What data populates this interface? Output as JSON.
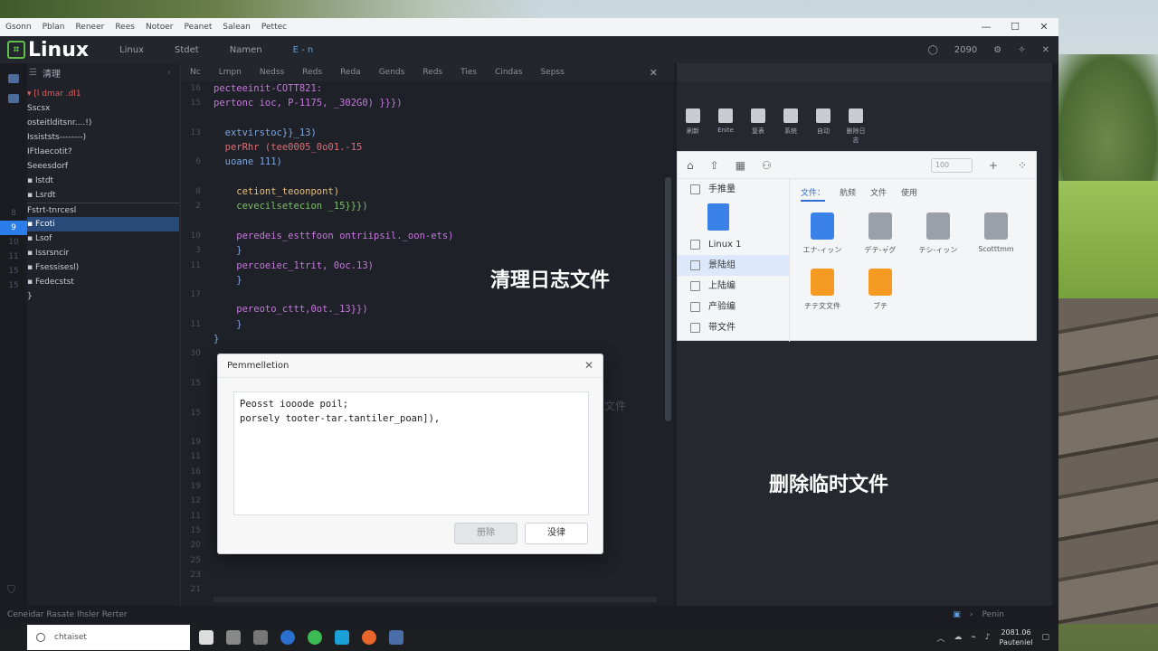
{
  "menubar": {
    "items": [
      "Gsonn",
      "Pblan",
      "Reneer",
      "Rees",
      "Notoer",
      "Peanet",
      "Salean",
      "Pettec"
    ]
  },
  "titlebar": {
    "logo": "Linux",
    "tabs": [
      "Linux",
      "Stdet",
      "Namen",
      "E - n"
    ],
    "status": "2090"
  },
  "explorer": {
    "title": "清理",
    "gutter": [
      "",
      "",
      "",
      "",
      "",
      "",
      "",
      "",
      "8",
      "9",
      "10",
      "11",
      "15",
      "15",
      "",
      "",
      "",
      "",
      "",
      "23",
      "",
      "25"
    ],
    "tree": [
      "▾ [l dmar .dl1",
      "      Sscsx",
      "      osteitlditsnr....!)",
      "      Issiststs--------)",
      "      IFtlaecotit?",
      "      Seeesdorf",
      "    ▪ Istdt",
      "    ▪ Lsrdt",
      "  Fstrt-tnrcesl",
      "    ▪ Fcoti",
      "    ▪ Lsof",
      "    ▪ Issrsncir",
      "    ▪ Fsessisesl)",
      "    ▪ Fedecstst",
      "  }"
    ]
  },
  "editor": {
    "tabs": [
      "Nc",
      "Lmpn",
      "Nedss",
      "Reds",
      "Reda",
      "Gends",
      "Reds",
      "Ties",
      "Cindas",
      "Sepss"
    ],
    "line_numbers": [
      "16",
      "15",
      "",
      "13",
      "",
      "6",
      "",
      "8",
      "2",
      "",
      "10",
      "3",
      "11",
      "",
      "17",
      "",
      "11",
      "",
      "30",
      "",
      "15",
      "",
      "15",
      "",
      "19",
      "11",
      "16",
      "19",
      "12",
      "11",
      "15",
      "20",
      "25",
      "23",
      "21"
    ],
    "code": [
      "pecteeinit-COTT821:",
      "pertonc ioc, P-1175, _302G0) }}})",
      "",
      "  extvirstoc}}_13)",
      "  perRhr (tee0005_0o01.-15",
      "  uoane 111)",
      "",
      "    cetiont_teoonpont)",
      "    cevecilsetecion _15}}})",
      "",
      "    peredeis_esttfoon ontriipsil._oon-ets)",
      "    }",
      "    percoeiec_1trit, 0oc.13)",
      "    }",
      "",
      "    pereoto_cttt,0ot._13}})",
      "    }",
      "}"
    ],
    "ghost_text": "文件"
  },
  "overlays": {
    "clean_logs": "清理日志文件",
    "delete_temp": "删除临时文件"
  },
  "dialog": {
    "title": "Pemmelletion",
    "lines": [
      "Peosst iooode poil;",
      "porsely tooter-tar.tantiler_poan]),"
    ],
    "delete_label": "册除",
    "confirm_label": "没律"
  },
  "rightpanel": {
    "toolbar": [
      "刷新",
      "Enite",
      "复表",
      "系统",
      "自动",
      "删除日志"
    ],
    "filemanager": {
      "search_placeholder": "100",
      "sidebar": [
        {
          "label": "手推量",
          "selected": false
        },
        {
          "label": "Linux 1",
          "selected": false
        },
        {
          "label": "景陆组",
          "selected": true
        },
        {
          "label": "上陆编",
          "selected": false
        },
        {
          "label": "产验编",
          "selected": false
        },
        {
          "label": "带文件",
          "selected": false
        }
      ],
      "tabs": [
        "文件：",
        "航频",
        "文件",
        "使用"
      ],
      "items": [
        {
          "label": "エナ-ィッン",
          "color": "#3b82e8"
        },
        {
          "label": "デテ-ャ゙グ",
          "color": "#9aa0aa"
        },
        {
          "label": "テシ-ィッン",
          "color": "#9aa0aa"
        },
        {
          "label": "Scotttmm",
          "color": "#9aa0aa"
        },
        {
          "label": "チテ文文件",
          "color": "#f59a23"
        },
        {
          "label": "ブチ",
          "color": "#f59a23"
        }
      ]
    }
  },
  "statusbar": {
    "left": "Ceneidar  Rasate Ihsler  Rerter",
    "right": "Penin"
  },
  "taskbar": {
    "search": "chtaiset",
    "time": "2081.06",
    "date": "Pauteniel"
  }
}
